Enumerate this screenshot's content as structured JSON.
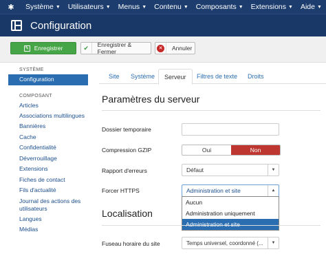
{
  "topnav": {
    "items": [
      {
        "label": "Système"
      },
      {
        "label": "Utilisateurs"
      },
      {
        "label": "Menus"
      },
      {
        "label": "Contenu"
      },
      {
        "label": "Composants"
      },
      {
        "label": "Extensions"
      },
      {
        "label": "Aide"
      }
    ]
  },
  "header": {
    "title": "Configuration"
  },
  "toolbar": {
    "save_label": "Enregistrer",
    "save_close_label": "Enregistrer & Fermer",
    "cancel_label": "Annuler"
  },
  "sidebar": {
    "system_heading": "SYSTÈME",
    "system_items": [
      {
        "label": "Configuration"
      }
    ],
    "component_heading": "COMPOSANT",
    "component_items": [
      {
        "label": "Articles"
      },
      {
        "label": "Associations multilingues"
      },
      {
        "label": "Bannières"
      },
      {
        "label": "Cache"
      },
      {
        "label": "Confidentialité"
      },
      {
        "label": "Déverrouillage"
      },
      {
        "label": "Extensions"
      },
      {
        "label": "Fiches de contact"
      },
      {
        "label": "Fils d'actualité"
      },
      {
        "label": "Journal des actions des utilisateurs"
      },
      {
        "label": "Langues"
      },
      {
        "label": "Médias"
      }
    ]
  },
  "tabs": [
    {
      "label": "Site"
    },
    {
      "label": "Système"
    },
    {
      "label": "Serveur"
    },
    {
      "label": "Filtres de texte"
    },
    {
      "label": "Droits"
    }
  ],
  "server": {
    "title": "Paramètres du serveur",
    "temp_folder_label": "Dossier temporaire",
    "temp_folder_value": "",
    "gzip_label": "Compression GZIP",
    "gzip_yes": "Oui",
    "gzip_no": "Non",
    "error_report_label": "Rapport d'erreurs",
    "error_report_value": "Défaut",
    "force_https_label": "Forcer HTTPS",
    "force_https_value": "Administration et site",
    "force_https_options": [
      {
        "label": "Aucun"
      },
      {
        "label": "Administration uniquement"
      },
      {
        "label": "Administration et site"
      }
    ]
  },
  "locale": {
    "title": "Localisation",
    "timezone_label": "Fuseau horaire du site",
    "timezone_value": "Temps universel, coordonné (..."
  }
}
